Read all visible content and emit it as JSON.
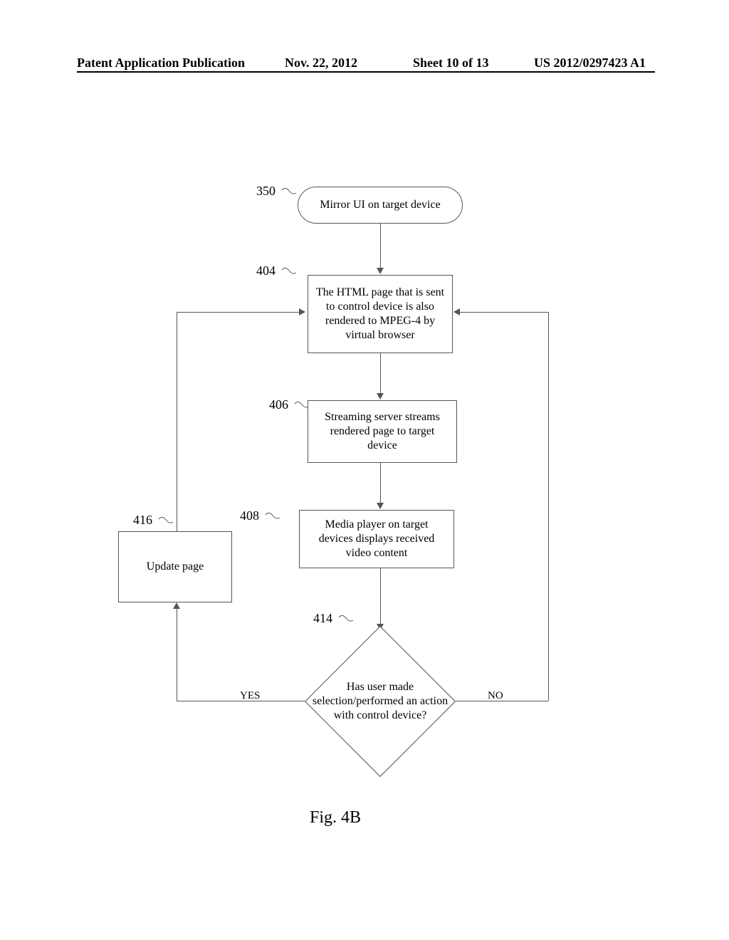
{
  "header": {
    "left": "Patent Application Publication",
    "date": "Nov. 22, 2012",
    "sheet": "Sheet 10 of 13",
    "pubno": "US 2012/0297423 A1"
  },
  "refs": {
    "r350": "350",
    "r404": "404",
    "r406": "406",
    "r408": "408",
    "r414": "414",
    "r416": "416"
  },
  "nodes": {
    "start": "Mirror UI on target device",
    "step404": "The HTML page that is sent to control device is also rendered to MPEG-4 by virtual browser",
    "step406": "Streaming server streams rendered page to target device",
    "step408": "Media player on target devices displays received video content",
    "decision414": "Has user made selection/performed an action with control device?",
    "step416": "Update page"
  },
  "edges": {
    "yes": "YES",
    "no": "NO"
  },
  "figure": "Fig. 4B",
  "chart_data": {
    "type": "flowchart",
    "nodes": [
      {
        "id": "350",
        "kind": "terminator",
        "text": "Mirror UI on target device"
      },
      {
        "id": "404",
        "kind": "process",
        "text": "The HTML page that is sent to control device is also rendered to MPEG-4 by virtual browser"
      },
      {
        "id": "406",
        "kind": "process",
        "text": "Streaming server streams rendered page to target device"
      },
      {
        "id": "408",
        "kind": "process",
        "text": "Media player on target devices displays received video content"
      },
      {
        "id": "414",
        "kind": "decision",
        "text": "Has user made selection/performed an action with control device?"
      },
      {
        "id": "416",
        "kind": "process",
        "text": "Update page"
      }
    ],
    "edges": [
      {
        "from": "350",
        "to": "404"
      },
      {
        "from": "404",
        "to": "406"
      },
      {
        "from": "406",
        "to": "408"
      },
      {
        "from": "408",
        "to": "414"
      },
      {
        "from": "414",
        "to": "416",
        "label": "YES"
      },
      {
        "from": "416",
        "to": "404"
      },
      {
        "from": "414",
        "to": "404",
        "label": "NO"
      }
    ],
    "caption": "Fig. 4B"
  }
}
